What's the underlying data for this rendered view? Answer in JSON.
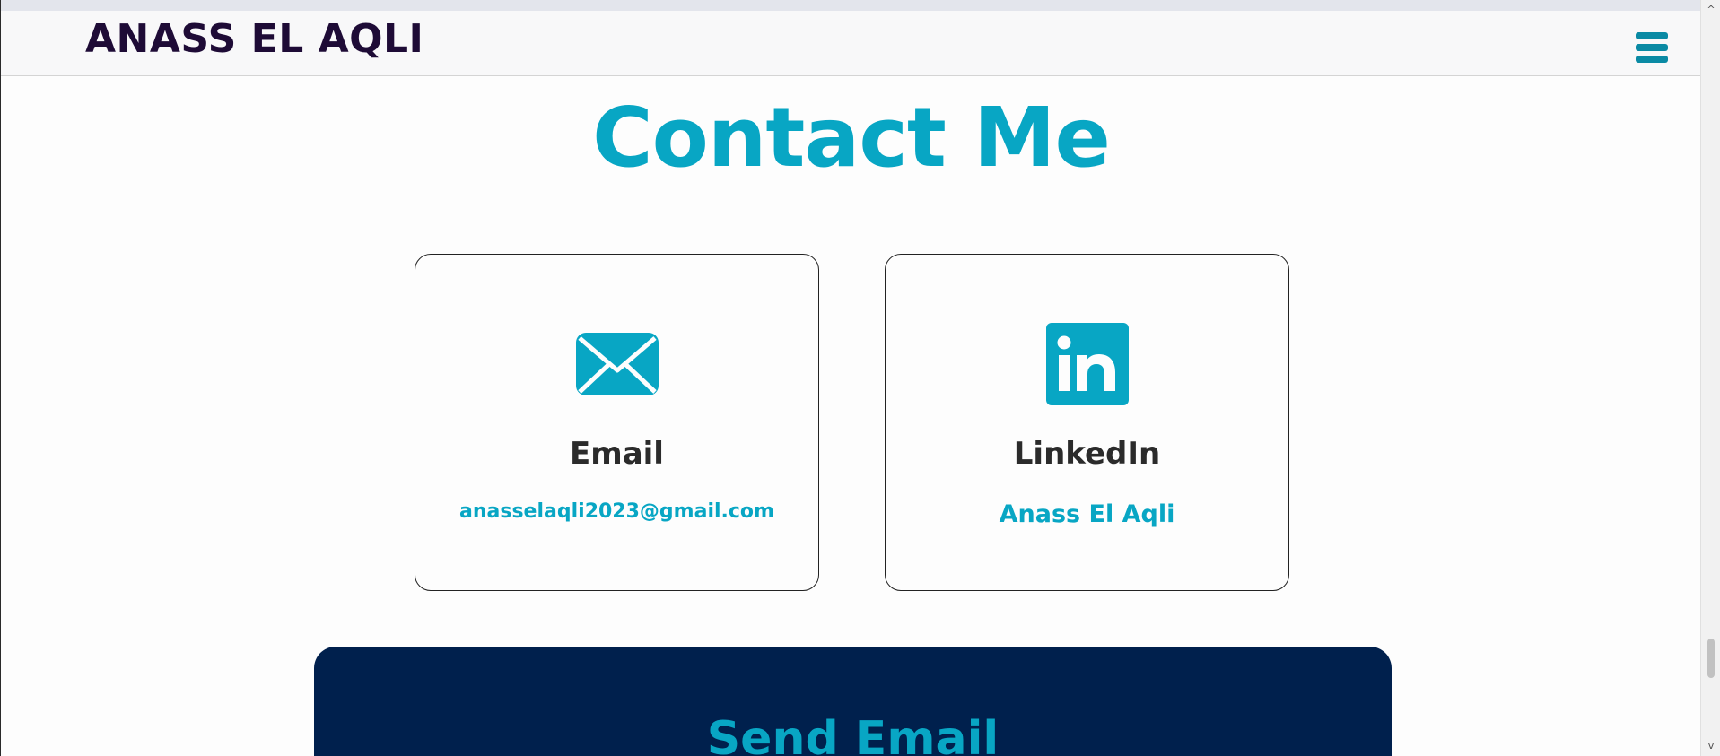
{
  "header": {
    "brand": "ANASS EL AQLI",
    "menu_icon": "hamburger-menu-icon"
  },
  "contact": {
    "heading": "Contact Me",
    "email_card": {
      "icon": "envelope-icon",
      "title": "Email",
      "value": "anasselaqli2023@gmail.com"
    },
    "linkedin_card": {
      "icon": "linkedin-icon",
      "title": "LinkedIn",
      "value": "Anass El Aqli"
    }
  },
  "send_panel": {
    "title": "Send Email"
  },
  "colors": {
    "accent": "#08a6c4",
    "brand_text": "#1e0b36",
    "panel_bg": "#00204d",
    "menu_icon": "#0a8aa4"
  },
  "scrollbar": {
    "up_arrow": "^",
    "down_arrow": "v"
  }
}
